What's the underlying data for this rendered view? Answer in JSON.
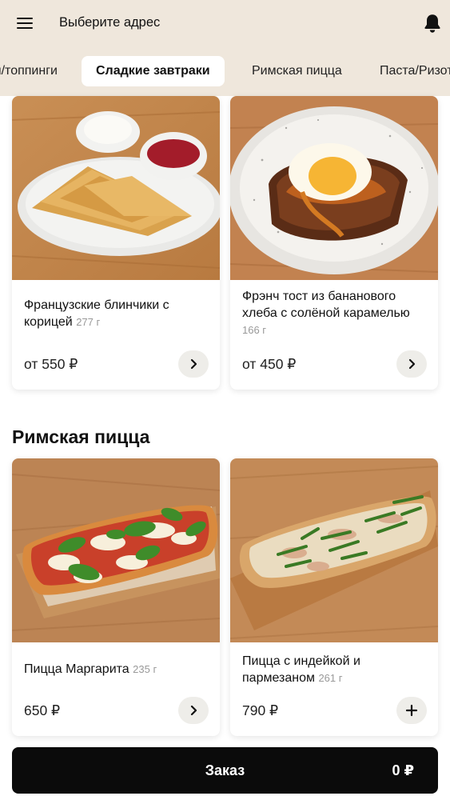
{
  "header": {
    "address_label": "Выберите адрес",
    "menu_icon": "hamburger-menu-icon",
    "notifications_icon": "bell-icon"
  },
  "tabs": [
    {
      "label": "Соусы/топпинги"
    },
    {
      "label": "Сладкие завтраки",
      "active": true
    },
    {
      "label": "Римская пицца"
    },
    {
      "label": "Паста/Ризотто"
    }
  ],
  "sweet_breakfasts": {
    "items": [
      {
        "name": "Французские блинчики с корицей",
        "weight": "277 г",
        "price": "от 550 ₽",
        "action_icon": "chevron-right-icon"
      },
      {
        "name": "Фрэнч тост из бананового хлеба с солёной карамелью",
        "weight": "166 г",
        "price": "от 450 ₽",
        "action_icon": "chevron-right-icon"
      }
    ]
  },
  "roman_pizza": {
    "title": "Римская пицца",
    "items": [
      {
        "name": "Пицца Маргарита",
        "weight": "235 г",
        "price": "650 ₽",
        "action_icon": "chevron-right-icon"
      },
      {
        "name": "Пицца с индейкой и пармезаном",
        "weight": "261 г",
        "price": "790 ₽",
        "action_icon": "plus-icon"
      }
    ]
  },
  "order_bar": {
    "label": "Заказ",
    "total": "0 ₽"
  },
  "colors": {
    "header_bg": "#efe7dc",
    "order_bar_bg": "#0b0b0b",
    "button_bg": "#eeede9"
  }
}
